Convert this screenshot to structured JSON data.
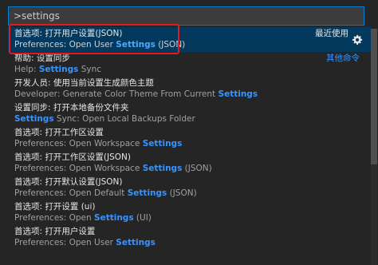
{
  "search": {
    "value": ">settings"
  },
  "items": [
    {
      "line1": "首选项: 打开用户设置(JSON)",
      "line2_pre": "Preferences: Open User ",
      "line2_hl": "Settings",
      "line2_post": " (JSON)",
      "right": "最近使用"
    },
    {
      "line1": "帮助: 设置同步",
      "line2_pre": "Help: ",
      "line2_hl": "Settings",
      "line2_post": " Sync",
      "right": "其他命令"
    },
    {
      "line1": "开发人员: 使用当前设置生成颜色主题",
      "line2_pre": "Developer: Generate Color Theme From Current ",
      "line2_hl": "Settings",
      "line2_post": ""
    },
    {
      "line1": "设置同步: 打开本地备份文件夹",
      "line2_pre": "",
      "line2_hl": "Settings",
      "line2_post": " Sync: Open Local Backups Folder"
    },
    {
      "line1": "首选项: 打开工作区设置",
      "line2_pre": "Preferences: Open Workspace ",
      "line2_hl": "Settings",
      "line2_post": ""
    },
    {
      "line1": "首选项: 打开工作区设置(JSON)",
      "line2_pre": "Preferences: Open Workspace ",
      "line2_hl": "Settings",
      "line2_post": " (JSON)"
    },
    {
      "line1": "首选项: 打开默认设置(JSON)",
      "line2_pre": "Preferences: Open Default ",
      "line2_hl": "Settings",
      "line2_post": " (JSON)"
    },
    {
      "line1": "首选项: 打开设置 (ui)",
      "line2_pre": "Preferences: Open ",
      "line2_hl": "Settings",
      "line2_post": " (UI)"
    },
    {
      "line1": "首选项: 打开用户设置",
      "line2_pre": "Preferences: Open User ",
      "line2_hl": "Settings",
      "line2_post": ""
    }
  ],
  "colors": {
    "accent": "#3794ff",
    "selection": "#04395e",
    "annotation": "#e01b24"
  }
}
